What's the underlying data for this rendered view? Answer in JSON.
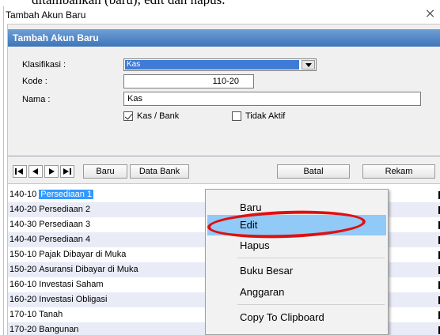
{
  "doc_text": "ditambahkan (baru), edit dan hapus.",
  "window": {
    "title": "Tambah Akun Baru"
  },
  "form": {
    "header": "Tambah Akun Baru",
    "klasifikasi_label": "Klasifikasi :",
    "klasifikasi_value": "Kas",
    "kode_label": "Kode :",
    "kode_value": "110-20",
    "nama_label": "Nama :",
    "nama_value": "Kas",
    "kas_bank_label": "Kas / Bank",
    "kas_bank_checked": true,
    "tidak_aktif_label": "Tidak Aktif",
    "tidak_aktif_checked": false
  },
  "toolbar": {
    "baru": "Baru",
    "data_bank": "Data Bank",
    "batal": "Batal",
    "rekam": "Rekam"
  },
  "accounts": [
    {
      "code": "140-10",
      "name": "Persediaan 1",
      "selected": true
    },
    {
      "code": "140-20",
      "name": "Persediaan 2"
    },
    {
      "code": "140-30",
      "name": "Persediaan 3"
    },
    {
      "code": "140-40",
      "name": "Persediaan 4"
    },
    {
      "code": "150-10",
      "name": "Pajak Dibayar di Muka"
    },
    {
      "code": "150-20",
      "name": "Asuransi Dibayar di Muka"
    },
    {
      "code": "160-10",
      "name": "Investasi Saham"
    },
    {
      "code": "160-20",
      "name": "Investasi Obligasi"
    },
    {
      "code": "170-10",
      "name": "Tanah"
    },
    {
      "code": "170-20",
      "name": "Bangunan"
    }
  ],
  "context_menu": {
    "items": [
      {
        "label": "Baru"
      },
      {
        "label": "Edit",
        "highlighted": true
      },
      {
        "label": "Hapus"
      },
      {
        "label": "Buku Besar"
      },
      {
        "label": "Anggaran"
      },
      {
        "label": "Copy To Clipboard"
      }
    ]
  },
  "colors": {
    "header_blue": "#3f74b8",
    "selection_blue": "#3399ff",
    "menu_highlight": "#91c9f7",
    "annotation_red": "#e01010",
    "row_alt": "#e9ecf7"
  }
}
